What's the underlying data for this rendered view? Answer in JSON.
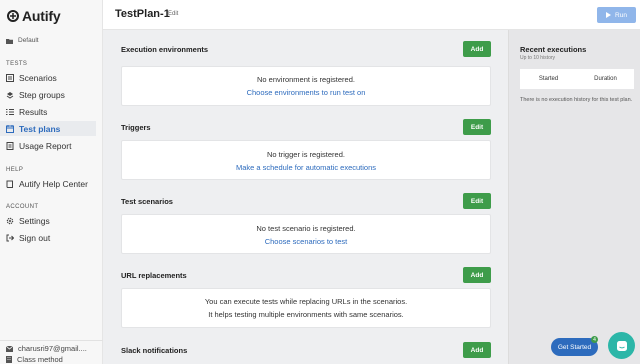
{
  "app": {
    "name": "Autify"
  },
  "sidebar": {
    "project": "Default",
    "tests_label": "TESTS",
    "tests_items": [
      {
        "label": "Scenarios",
        "icon": "scenarios-icon"
      },
      {
        "label": "Step groups",
        "icon": "step-groups-icon"
      },
      {
        "label": "Results",
        "icon": "results-icon"
      },
      {
        "label": "Test plans",
        "icon": "calendar-icon",
        "active": true
      },
      {
        "label": "Usage Report",
        "icon": "report-icon"
      }
    ],
    "help_label": "HELP",
    "help_items": [
      {
        "label": "Autify Help Center",
        "icon": "book-icon"
      }
    ],
    "account_label": "ACCOUNT",
    "account_items": [
      {
        "label": "Settings",
        "icon": "gear-icon"
      },
      {
        "label": "Sign out",
        "icon": "sign-out-icon"
      }
    ],
    "user_email": "charusri97@gmail....",
    "user_org": "Class method"
  },
  "header": {
    "title": "TestPlan-1",
    "edit_label": "Edit",
    "run_label": "Run"
  },
  "sections": {
    "environments": {
      "title": "Execution environments",
      "button": "Add",
      "message": "No environment is registered.",
      "link": "Choose environments to run test on"
    },
    "triggers": {
      "title": "Triggers",
      "button": "Edit",
      "message": "No trigger is registered.",
      "link": "Make a schedule for automatic executions"
    },
    "scenarios": {
      "title": "Test scenarios",
      "button": "Edit",
      "message": "No test scenario is registered.",
      "link": "Choose scenarios to test"
    },
    "url_replacements": {
      "title": "URL replacements",
      "button": "Add",
      "line1": "You can execute tests while replacing URLs in the scenarios.",
      "line2": "It helps testing multiple environments with same scenarios."
    },
    "slack": {
      "title": "Slack notifications",
      "button": "Add"
    }
  },
  "recent": {
    "title": "Recent executions",
    "subtitle": "Up to 10 history",
    "col_started": "Started",
    "col_duration": "Duration",
    "empty": "There is no execution history for this test plan."
  },
  "floating": {
    "get_started": "Get Started",
    "badge": "4"
  },
  "colors": {
    "accent": "#2d6bbd",
    "green": "#3e9c4a",
    "run_disabled": "#90b6ea",
    "chat": "#2cb6a8"
  }
}
